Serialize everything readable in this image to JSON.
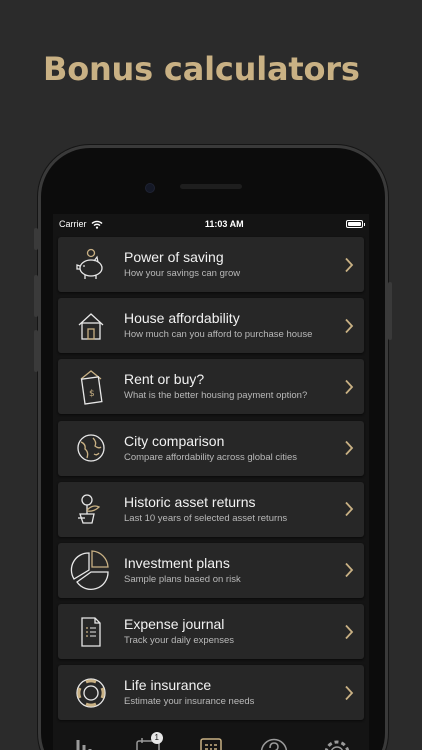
{
  "headline": "Bonus calculators",
  "status": {
    "carrier": "Carrier",
    "time": "11:03 AM"
  },
  "colors": {
    "accent": "#c9b184",
    "card": "#272727",
    "screen": "#141414",
    "background": "#2b2b2b"
  },
  "items": [
    {
      "icon": "piggy-bank-icon",
      "title": "Power of saving",
      "subtitle": "How your savings can grow"
    },
    {
      "icon": "house-icon",
      "title": "House affordability",
      "subtitle": "How much can you afford to purchase house"
    },
    {
      "icon": "house-document-icon",
      "title": "Rent or buy?",
      "subtitle": "What is the better housing payment option?"
    },
    {
      "icon": "globe-icon",
      "title": "City comparison",
      "subtitle": "Compare affordability across global cities"
    },
    {
      "icon": "coin-plant-icon",
      "title": "Historic asset returns",
      "subtitle": "Last 10 years of selected asset returns"
    },
    {
      "icon": "pie-chart-icon",
      "title": "Investment plans",
      "subtitle": "Sample plans based on risk"
    },
    {
      "icon": "journal-icon",
      "title": "Expense journal",
      "subtitle": "Track your daily expenses"
    },
    {
      "icon": "lifebuoy-icon",
      "title": "Life insurance",
      "subtitle": "Estimate your insurance needs"
    }
  ],
  "tabs": [
    {
      "icon": "bar-chart-icon"
    },
    {
      "icon": "calendar-icon",
      "badge": "1"
    },
    {
      "icon": "calculator-icon"
    },
    {
      "icon": "help-icon"
    },
    {
      "icon": "settings-icon"
    }
  ]
}
